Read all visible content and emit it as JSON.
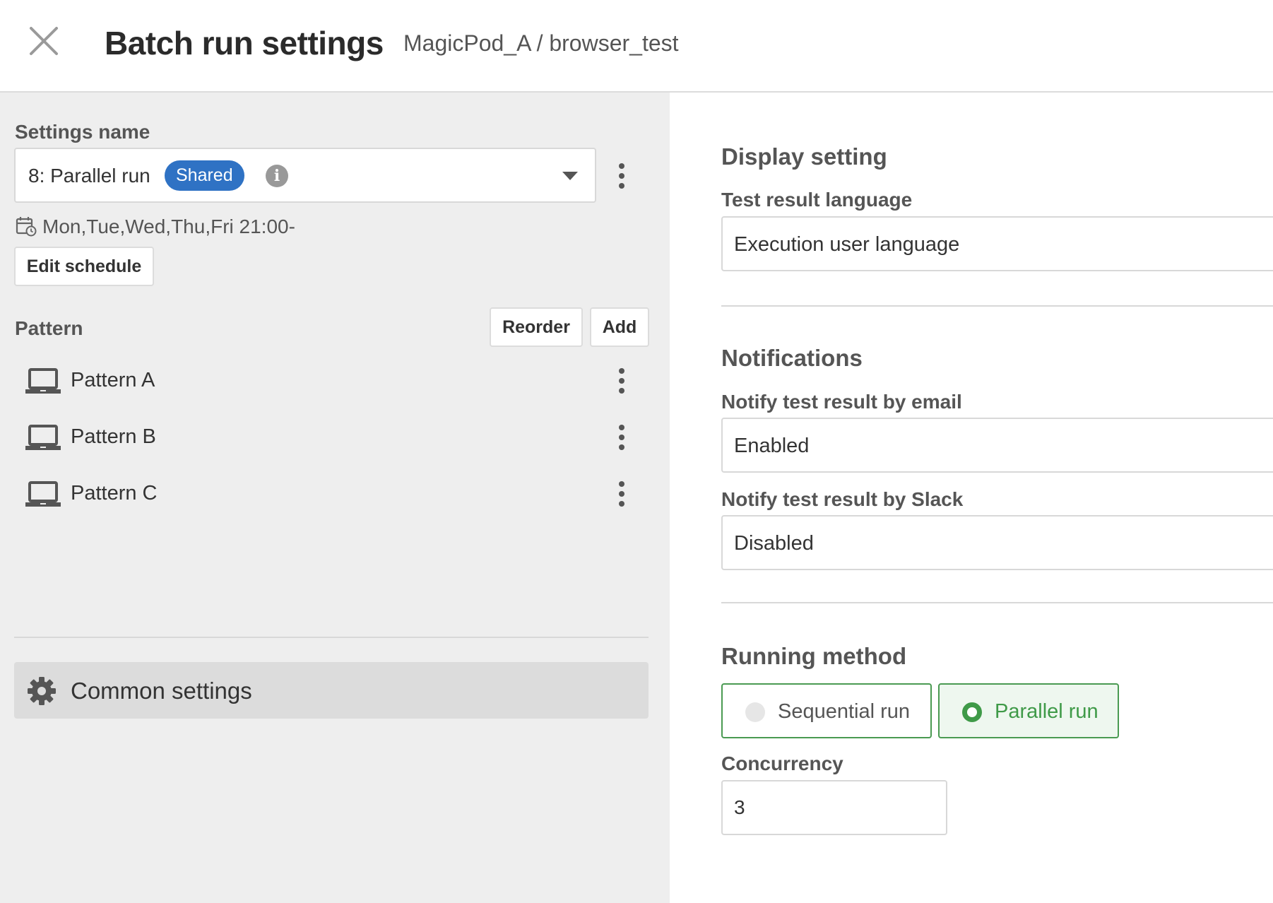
{
  "header": {
    "title": "Batch run settings",
    "breadcrumb": "MagicPod_A / browser_test",
    "close_icon": "close-icon"
  },
  "left": {
    "settings_name_label": "Settings name",
    "selected_setting": "8: Parallel run",
    "shared_badge": "Shared",
    "info_icon_glyph": "i",
    "schedule_text": "Mon,Tue,Wed,Thu,Fri 21:00-",
    "edit_schedule_label": "Edit schedule",
    "pattern_label": "Pattern",
    "reorder_label": "Reorder",
    "add_label": "Add",
    "patterns": [
      {
        "name": "Pattern A",
        "icon": "laptop-icon"
      },
      {
        "name": "Pattern B",
        "icon": "laptop-icon"
      },
      {
        "name": "Pattern C",
        "icon": "laptop-icon"
      }
    ],
    "common_settings_label": "Common settings"
  },
  "right": {
    "display_setting_title": "Display setting",
    "test_result_language_label": "Test result language",
    "test_result_language_value": "Execution user language",
    "notifications_title": "Notifications",
    "notify_email_label": "Notify test result by email",
    "notify_email_value": "Enabled",
    "notify_slack_label": "Notify test result by Slack",
    "notify_slack_value": "Disabled",
    "running_method_title": "Running method",
    "running_methods": [
      {
        "label": "Sequential run",
        "selected": false
      },
      {
        "label": "Parallel run",
        "selected": true
      }
    ],
    "concurrency_label": "Concurrency",
    "concurrency_value": "3"
  },
  "colors": {
    "accent_blue": "#2f72c4",
    "selected_green": "#3f9a48",
    "panel_gray": "#eeeeee"
  }
}
